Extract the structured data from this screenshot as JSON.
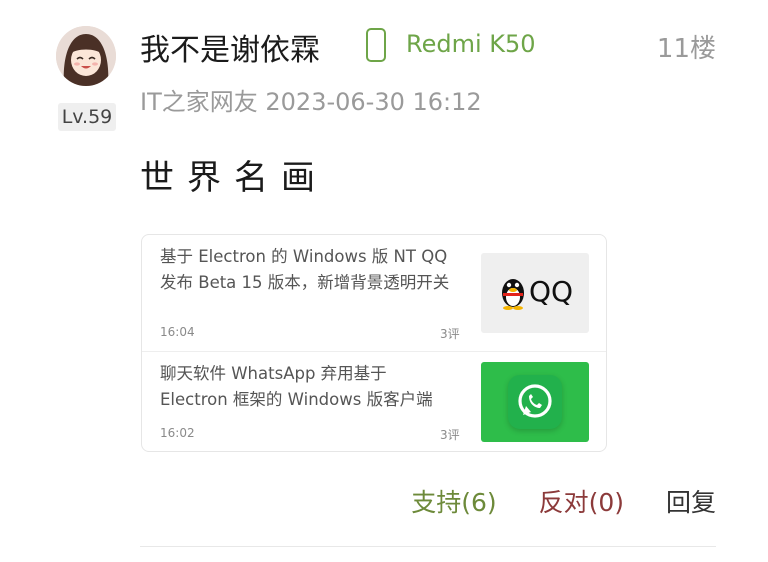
{
  "comment": {
    "username": "我不是谢依霖",
    "device": "Redmi K50",
    "floor": "11楼",
    "source": "IT之家网友",
    "datetime": "2023-06-30 16:12",
    "level": "Lv.59",
    "content": "世界名画"
  },
  "card": {
    "items": [
      {
        "title": "基于 Electron 的 Windows 版 NT QQ 发布 Beta 15 版本，新增背景透明开关",
        "time": "16:04",
        "comments": "3评",
        "thumb_text": "QQ"
      },
      {
        "title": "聊天软件 WhatsApp 弃用基于 Electron 框架的 Windows 版客户端",
        "time": "16:02",
        "comments": "3评"
      }
    ]
  },
  "actions": {
    "support": "支持(6)",
    "oppose": "反对(0)",
    "reply": "回复"
  },
  "colors": {
    "accent_green": "#6ea548",
    "support": "#6d8a3a",
    "oppose": "#8c3a3a",
    "whatsapp": "#2ebd4a"
  }
}
